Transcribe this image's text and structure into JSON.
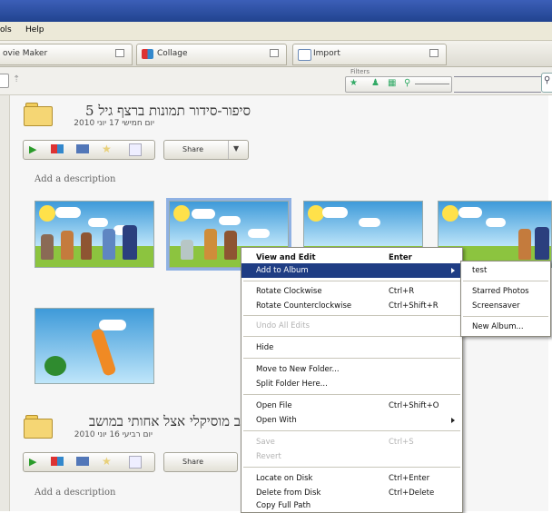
{
  "menubar": {
    "items": [
      "ols",
      "Help"
    ]
  },
  "tabs": [
    {
      "label": "ovie Maker"
    },
    {
      "label": "Collage"
    },
    {
      "label": "Import"
    }
  ],
  "toolbar": {
    "filters_label": "Filters"
  },
  "folders": [
    {
      "title": "סיפור-סידור תמונות ברצף גיל 5",
      "date": "יום חמישי 17 יוני 2010",
      "share": "Share",
      "description": "Add a description"
    },
    {
      "title": "ב מוסיקלי אצל אחותי במושב",
      "date": "יום רביעי 16 יוני 2010",
      "share": "Share",
      "description": "Add a description"
    }
  ],
  "context_menu": {
    "items": [
      {
        "label": "View and Edit",
        "shortcut": "Enter",
        "bold": true
      },
      {
        "label": "Add to Album",
        "shortcut": "",
        "highlight": true,
        "submenu": true
      },
      {
        "label": "Rotate Clockwise",
        "shortcut": "Ctrl+R"
      },
      {
        "label": "Rotate Counterclockwise",
        "shortcut": "Ctrl+Shift+R"
      },
      {
        "label": "Undo All Edits",
        "shortcut": "",
        "disabled": true
      },
      {
        "label": "Hide",
        "shortcut": ""
      },
      {
        "label": "Move to New Folder...",
        "shortcut": ""
      },
      {
        "label": "Split Folder Here...",
        "shortcut": ""
      },
      {
        "label": "Open File",
        "shortcut": "Ctrl+Shift+O"
      },
      {
        "label": "Open With",
        "shortcut": "",
        "submenu": true
      },
      {
        "label": "Save",
        "shortcut": "Ctrl+S",
        "disabled": true
      },
      {
        "label": "Revert",
        "shortcut": "",
        "disabled": true
      },
      {
        "label": "Locate on Disk",
        "shortcut": "Ctrl+Enter"
      },
      {
        "label": "Delete from Disk",
        "shortcut": "Ctrl+Delete"
      },
      {
        "label": "Copy Full Path",
        "shortcut": ""
      }
    ]
  },
  "album_submenu": {
    "items": [
      "test",
      "Starred Photos",
      "Screensaver",
      "New Album..."
    ]
  },
  "colors": {
    "highlight": "#1f3d84",
    "titlebar": "#2a4ea6"
  }
}
